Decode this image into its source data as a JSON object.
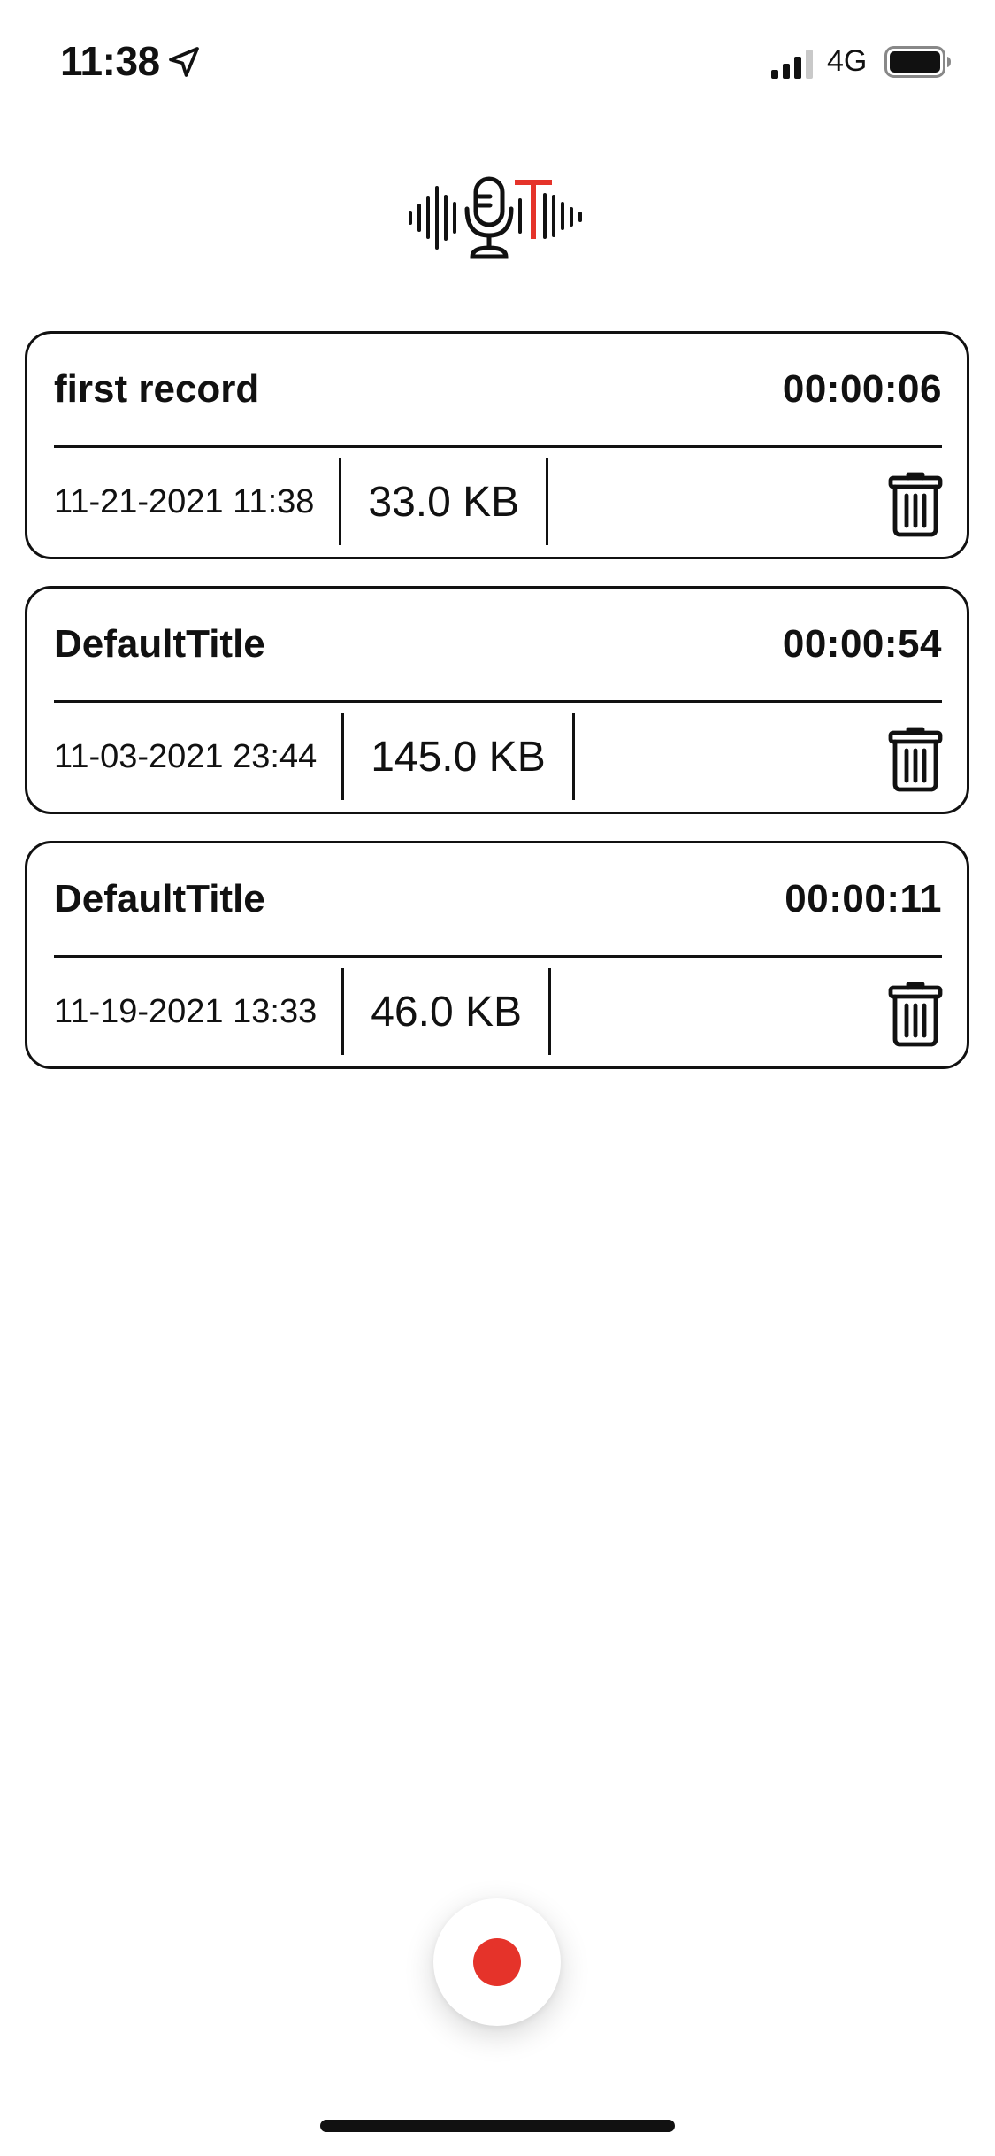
{
  "status_bar": {
    "time": "11:38",
    "network": "4G",
    "location_icon": "location-arrow-icon",
    "signal_icon": "cellular-signal-icon",
    "battery_icon": "battery-icon"
  },
  "header": {
    "logo_icon": "microphone-soundwave-logo"
  },
  "recordings": [
    {
      "title": "first record",
      "duration": "00:00:06",
      "date": "11-21-2021 11:38",
      "size": "33.0 KB"
    },
    {
      "title": "DefaultTitle",
      "duration": "00:00:54",
      "date": "11-03-2021 23:44",
      "size": "145.0 KB"
    },
    {
      "title": "DefaultTitle",
      "duration": "00:00:11",
      "date": "11-19-2021 13:33",
      "size": "46.0 KB"
    }
  ],
  "record_button": {
    "icon": "record-dot-icon"
  },
  "colors": {
    "accent": "#e5332a",
    "text": "#111111",
    "background": "#ffffff",
    "card_border": "#111111"
  }
}
